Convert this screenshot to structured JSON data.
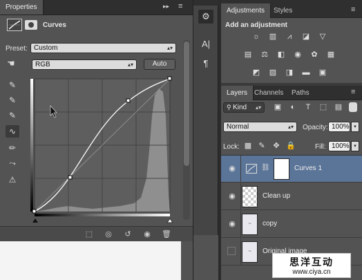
{
  "properties": {
    "tab_label": "Properties",
    "panel_title": "Curves",
    "preset_label": "Preset:",
    "preset_value": "Custom",
    "channel_value": "RGB",
    "auto_label": "Auto"
  },
  "adjustments": {
    "tabs": [
      "Adjustments",
      "Styles"
    ],
    "heading": "Add an adjustment"
  },
  "layers": {
    "tabs": [
      "Layers",
      "Channels",
      "Paths"
    ],
    "filter_value": "Kind",
    "blend_mode": "Normal",
    "opacity_label": "Opacity:",
    "opacity_value": "100%",
    "lock_label": "Lock:",
    "fill_label": "Fill:",
    "fill_value": "100%",
    "items": [
      {
        "name": "Curves 1"
      },
      {
        "name": "Clean up"
      },
      {
        "name": "copy"
      },
      {
        "name": "Original image"
      }
    ]
  },
  "watermark": {
    "chinese": "思洋互动",
    "url": "www.ciya.cn"
  },
  "colors": {
    "panel": "#535353",
    "tabbar": "#2f2f2f",
    "selected_layer": "#5b7598"
  }
}
